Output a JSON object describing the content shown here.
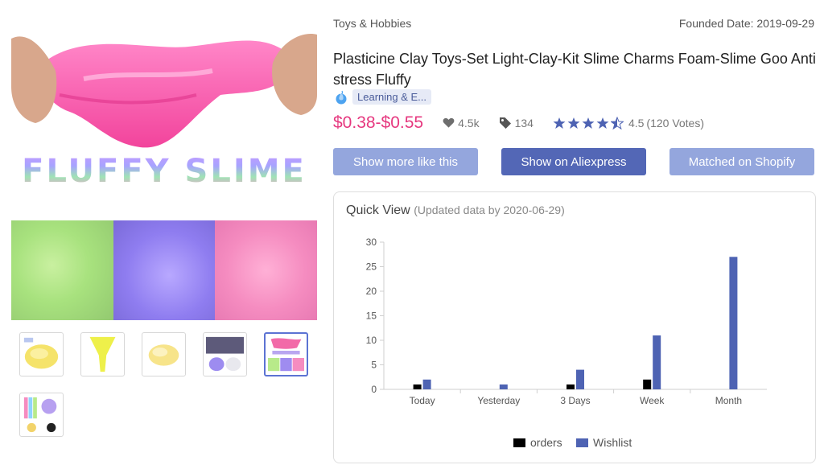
{
  "header": {
    "category": "Toys & Hobbies",
    "founded_date": "Founded Date: 2019-09-29"
  },
  "product": {
    "title": "Plasticine Clay Toys-Set Light-Clay-Kit Slime Charms Foam-Slime Goo Antistress Fluffy",
    "tag": "Learning & E...",
    "tag_icon": "flame-icon",
    "price": "$0.38-$0.55",
    "likes": "4.5k",
    "tags_count": "134",
    "rating": 4.5,
    "rating_score": "4.5",
    "rating_votes": "(120 Votes)",
    "image_text": "FLUFFY SLIME"
  },
  "buttons": {
    "more_like": "Show more like this",
    "aliexpress": "Show on Aliexpress",
    "shopify": "Matched on Shopify"
  },
  "quick_view": {
    "title": "Quick View",
    "updated": "(Updated data by 2020-06-29)"
  },
  "thumbnails": [
    {
      "name": "thumb-yellow-slime"
    },
    {
      "name": "thumb-yellow-stretch"
    },
    {
      "name": "thumb-yellow-fluff"
    },
    {
      "name": "thumb-purple-slime"
    },
    {
      "name": "thumb-fluffy-slime",
      "active": true
    },
    {
      "name": "thumb-colorful-set"
    }
  ],
  "colors": {
    "accent": "#5367b6",
    "accent_light": "#94a6dd",
    "price": "#e6387f",
    "orders": "#000000",
    "wishlist": "#4e63b3",
    "star": "#4e63b3"
  },
  "chart_data": {
    "type": "bar",
    "categories": [
      "Today",
      "Yesterday",
      "3 Days",
      "Week",
      "Month"
    ],
    "series": [
      {
        "name": "orders",
        "values": [
          1,
          0,
          1,
          2,
          0
        ]
      },
      {
        "name": "Wishlist",
        "values": [
          2,
          1,
          4,
          11,
          27
        ]
      }
    ],
    "ylim": [
      0,
      30
    ],
    "yticks": [
      0,
      5,
      10,
      15,
      20,
      25,
      30
    ],
    "legend": "bottom",
    "grid": false
  }
}
